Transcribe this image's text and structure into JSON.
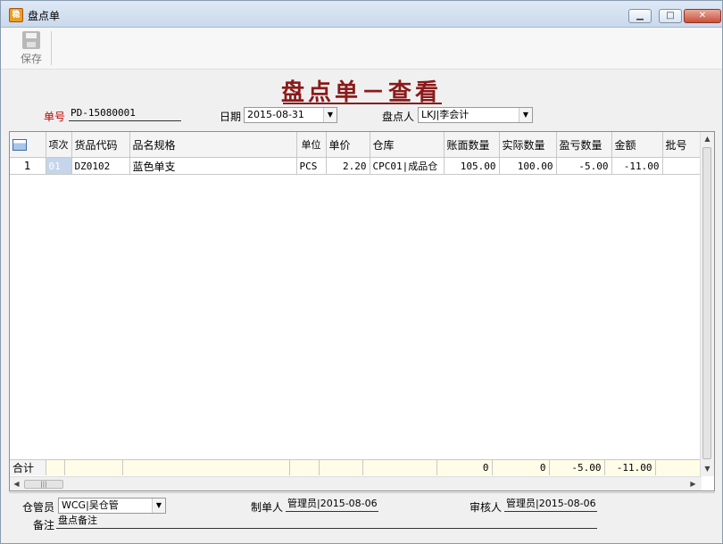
{
  "window": {
    "title": "盘点单",
    "app_icon_text": "稳",
    "minimize_symbol": "▁",
    "maximize_symbol": "□",
    "close_symbol": "✕"
  },
  "toolbar": {
    "save_label": "保存"
  },
  "heading": "盘点单－查看",
  "header": {
    "doc_no_label": "单号",
    "doc_no": "PD-15080001",
    "date_label": "日期",
    "date": "2015-08-31",
    "counter_label": "盘点人",
    "counter": "LKJ|李会计"
  },
  "grid": {
    "columns": [
      "项次",
      "货品代码",
      "品名规格",
      "单位",
      "单价",
      "仓库",
      "账面数量",
      "实际数量",
      "盈亏数量",
      "金额",
      "批号"
    ],
    "rows": [
      {
        "row_no": "1",
        "seq": "01",
        "code": "DZ0102",
        "name": "蓝色单支",
        "unit": "PCS",
        "price": "2.20",
        "warehouse": "CPC01|成品仓",
        "book_qty": "105.00",
        "actual_qty": "100.00",
        "diff_qty": "-5.00",
        "amount": "-11.00",
        "batch": ""
      }
    ],
    "totals": {
      "label": "合计",
      "book_qty": "0",
      "actual_qty": "0",
      "diff_qty": "-5.00",
      "amount": "-11.00"
    }
  },
  "footer": {
    "keeper_label": "仓管员",
    "keeper": "WCG|吴仓管",
    "maker_label": "制单人",
    "maker": "管理员|2015-08-06",
    "auditor_label": "审核人",
    "auditor": "管理员|2015-08-06",
    "remark_label": "备注",
    "remark": "盘点备注"
  },
  "colors": {
    "title_red": "#8b1a1a",
    "label_red": "#c00000",
    "total_row": "#fffde8",
    "seq_highlight": "#c5d5ea"
  },
  "icons": {
    "save": "save-disk-icon",
    "grid_header": "grid-table-icon"
  }
}
